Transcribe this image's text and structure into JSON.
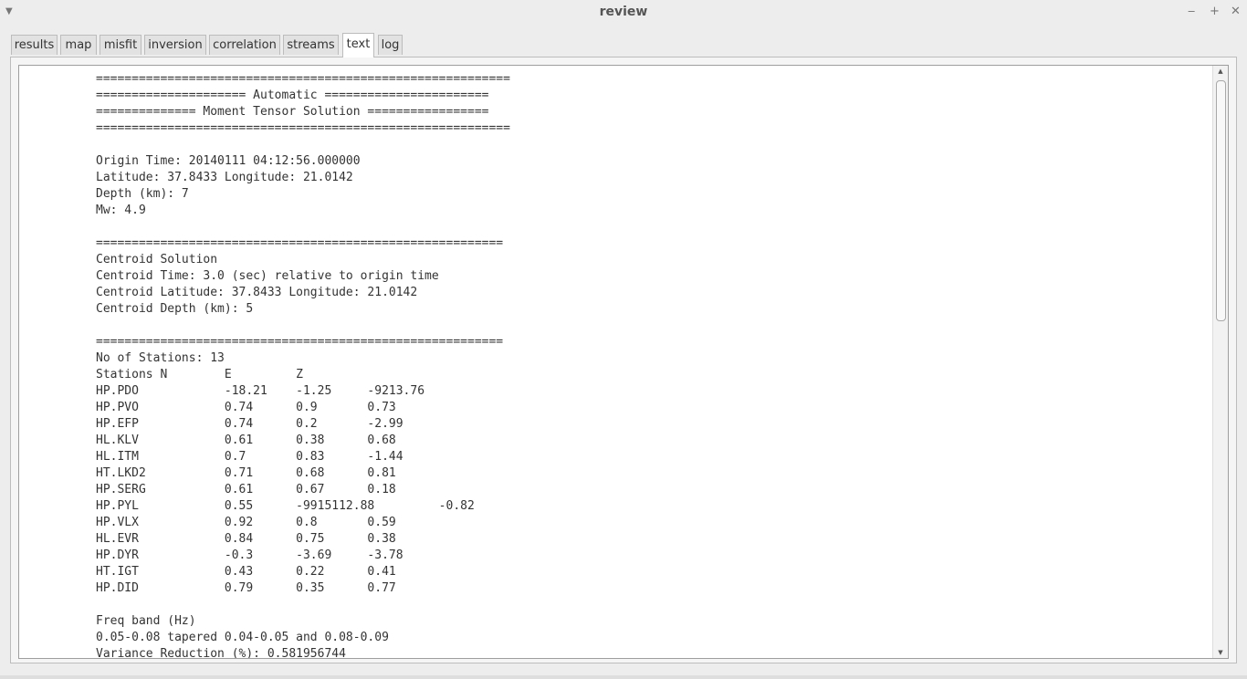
{
  "window": {
    "title": "review",
    "menu_icon": "▼",
    "minimize_icon": "‒",
    "maximize_icon": "+",
    "close_icon": "✕"
  },
  "tabs": [
    {
      "label": "results"
    },
    {
      "label": "map"
    },
    {
      "label": "misfit"
    },
    {
      "label": "inversion"
    },
    {
      "label": "correlation"
    },
    {
      "label": "streams"
    },
    {
      "label": "text",
      "active": true
    },
    {
      "label": "log"
    }
  ],
  "report": {
    "header_rule": "==========================================================",
    "header_automatic": "===================== Automatic =======================",
    "header_moment": "============== Moment Tensor Solution =================",
    "origin_time": "Origin Time: 20140111 04:12:56.000000",
    "origin_latlon": "Latitude: 37.8433 Longitude: 21.0142",
    "origin_depth": "Depth (km): 7",
    "mw": "Mw: 4.9",
    "rule2": "=========================================================",
    "centroid_title": "Centroid Solution",
    "centroid_time": "Centroid Time: 3.0 (sec) relative to origin time",
    "centroid_latlon": "Centroid Latitude: 37.8433 Longitude: 21.0142",
    "centroid_depth": "Centroid Depth (km): 5",
    "rule3": "=========================================================",
    "stations_count": "No of Stations: 13",
    "stations_header": "Stations N        E         Z",
    "stations": [
      "HP.PDO            -18.21    -1.25     -9213.76",
      "HP.PVO            0.74      0.9       0.73",
      "HP.EFP            0.74      0.2       -2.99",
      "HL.KLV            0.61      0.38      0.68",
      "HL.ITM            0.7       0.83      -1.44",
      "HT.LKD2           0.71      0.68      0.81",
      "HP.SERG           0.61      0.67      0.18",
      "HP.PYL            0.55      -9915112.88         -0.82",
      "HP.VLX            0.92      0.8       0.59",
      "HL.EVR            0.84      0.75      0.38",
      "HP.DYR            -0.3      -3.69     -3.78",
      "HT.IGT            0.43      0.22      0.41",
      "HP.DID            0.79      0.35      0.77"
    ],
    "freq_label": "Freq band (Hz)",
    "freq_value": "0.05-0.08 tapered 0.04-0.05 and 0.08-0.09",
    "variance": "Variance Reduction (%): 0.581956744"
  },
  "scrollbar": {
    "up_icon": "▲",
    "down_icon": "▼"
  }
}
